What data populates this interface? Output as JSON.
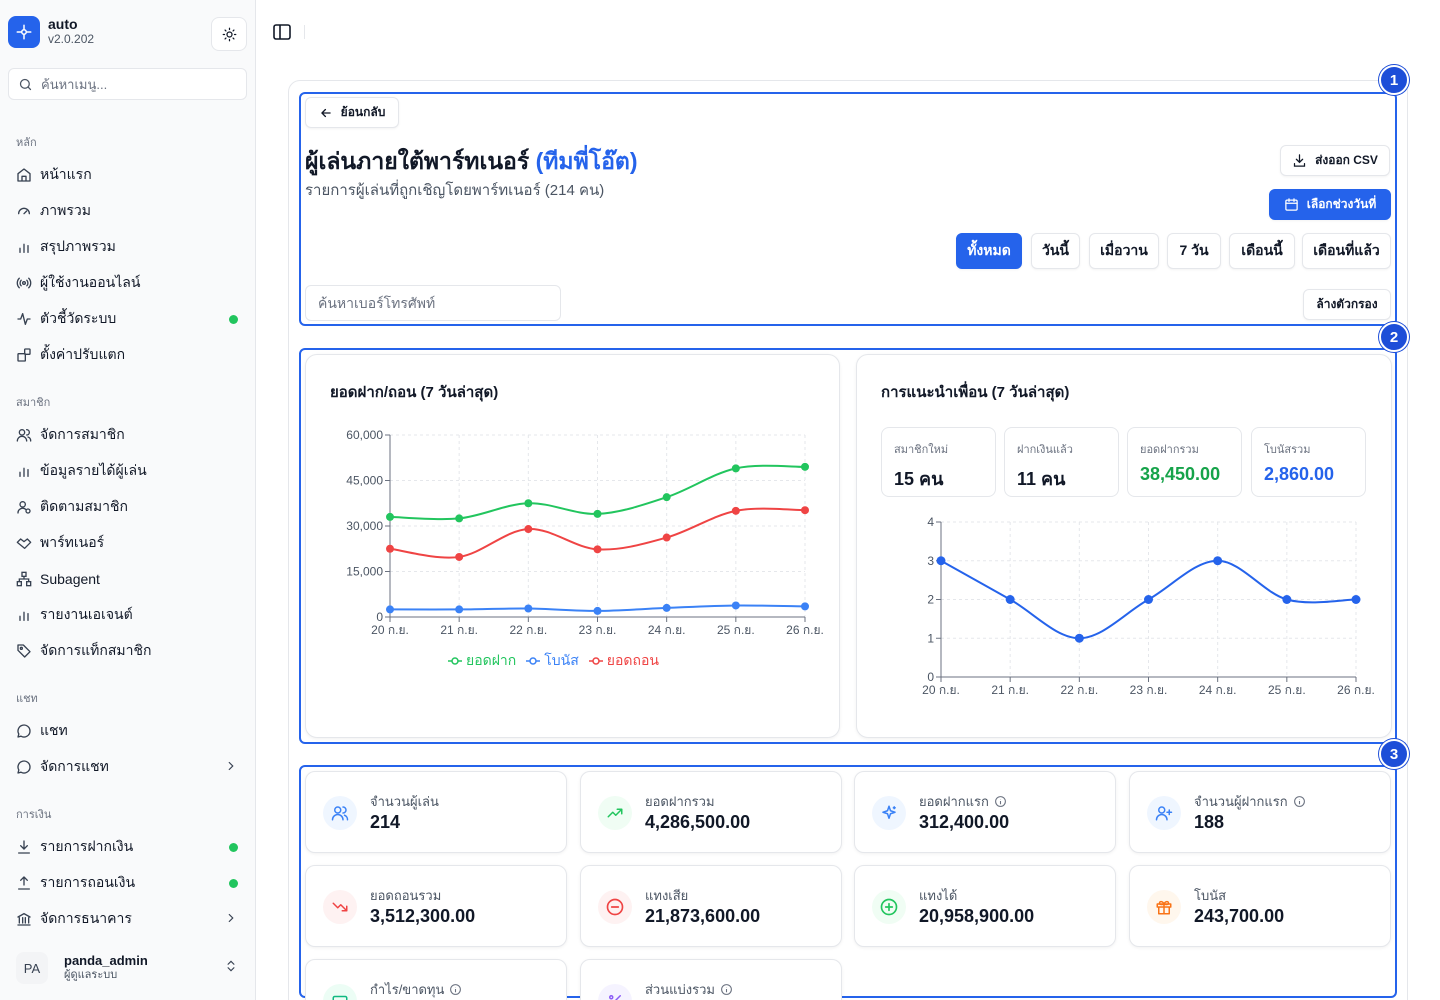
{
  "app": {
    "name": "auto",
    "version": "v2.0.202"
  },
  "sidebar": {
    "search_placeholder": "ค้นหาเมนู...",
    "sections": [
      {
        "title": "หลัก",
        "items": [
          {
            "label": "หน้าแรก"
          },
          {
            "label": "ภาพรวม"
          },
          {
            "label": "สรุปภาพรวม"
          },
          {
            "label": "ผู้ใช้งานออนไลน์"
          },
          {
            "label": "ตัวชี้วัดระบบ"
          },
          {
            "label": "ตั้งค่าปรับแตก"
          }
        ]
      },
      {
        "title": "สมาชิก",
        "items": [
          {
            "label": "จัดการสมาชิก"
          },
          {
            "label": "ข้อมูลรายได้ผู้เล่น"
          },
          {
            "label": "ติดตามสมาชิก"
          },
          {
            "label": "พาร์ทเนอร์"
          },
          {
            "label": "Subagent"
          },
          {
            "label": "รายงานเอเจนต์"
          },
          {
            "label": "จัดการแท็กสมาชิก"
          }
        ]
      },
      {
        "title": "แชท",
        "items": [
          {
            "label": "แชท"
          },
          {
            "label": "จัดการแชท"
          }
        ]
      },
      {
        "title": "การเงิน",
        "items": [
          {
            "label": "รายการฝากเงิน"
          },
          {
            "label": "รายการถอนเงิน"
          },
          {
            "label": "จัดการธนาคาร"
          }
        ]
      }
    ],
    "user": {
      "initials": "PA",
      "name": "panda_admin",
      "role": "ผู้ดูแลระบบ"
    }
  },
  "badges": [
    "1",
    "2",
    "3"
  ],
  "header": {
    "back_label": "ย้อนกลับ",
    "title": "ผู้เล่นภายใต้พาร์ทเนอร์",
    "title_accent": "(ทีมพี่โอ๊ต)",
    "subtitle": "รายการผู้เล่นที่ถูกเชิญโดยพาร์ทเนอร์ (214 คน)",
    "export_label": "ส่งออก CSV",
    "date_range_label": "เลือกช่วงวันที่",
    "filters": [
      "ทั้งหมด",
      "วันนี้",
      "เมื่อวาน",
      "7 วัน",
      "เดือนนี้",
      "เดือนที่แล้ว"
    ],
    "active_filter": 0,
    "phone_placeholder": "ค้นหาเบอร์โทรศัพท์",
    "clear_label": "ล้างตัวกรอง"
  },
  "colors": {
    "accent": "#2563eb",
    "deposit": "#22c55e",
    "bonus": "#3b82f6",
    "withdraw": "#ef4444"
  },
  "chart_data": [
    {
      "type": "line",
      "title": "ยอดฝาก/ถอน (7 วันล่าสุด)",
      "categories": [
        "20 ก.ย.",
        "21 ก.ย.",
        "22 ก.ย.",
        "23 ก.ย.",
        "24 ก.ย.",
        "25 ก.ย.",
        "26 ก.ย."
      ],
      "yticks": [
        "0",
        "15,000",
        "30,000",
        "45,000",
        "60,000"
      ],
      "ylim": [
        0,
        60000
      ],
      "grid": true,
      "legend_position": "bottom",
      "series": [
        {
          "name": "ยอดฝาก",
          "color": "#22c55e",
          "values": [
            33000,
            32500,
            37500,
            34000,
            39500,
            49000,
            49500
          ]
        },
        {
          "name": "โบนัส",
          "color": "#3b82f6",
          "values": [
            2500,
            2500,
            2800,
            2000,
            3000,
            3800,
            3500
          ]
        },
        {
          "name": "ยอดถอน",
          "color": "#ef4444",
          "values": [
            22500,
            19800,
            29000,
            22300,
            26200,
            35000,
            35200
          ]
        }
      ]
    },
    {
      "type": "line",
      "title": "การแนะนำเพื่อน (7 วันล่าสุด)",
      "categories": [
        "20 ก.ย.",
        "21 ก.ย.",
        "22 ก.ย.",
        "23 ก.ย.",
        "24 ก.ย.",
        "25 ก.ย.",
        "26 ก.ย."
      ],
      "yticks": [
        "0",
        "1",
        "2",
        "3",
        "4"
      ],
      "ylim": [
        0,
        4
      ],
      "grid": true,
      "series": [
        {
          "color": "#2563eb",
          "values": [
            3,
            2,
            1,
            2,
            3,
            2,
            2
          ]
        }
      ]
    }
  ],
  "referral_stats": [
    {
      "label": "สมาชิกใหม่",
      "value": "15 คน",
      "color": "#111827"
    },
    {
      "label": "ฝากเงินแล้ว",
      "value": "11 คน",
      "color": "#111827"
    },
    {
      "label": "ยอดฝากรวม",
      "value": "38,450.00",
      "color": "#16a34a"
    },
    {
      "label": "โบนัสรวม",
      "value": "2,860.00",
      "color": "#2563eb"
    }
  ],
  "stats": [
    {
      "label": "จำนวนผู้เล่น",
      "value": "214",
      "icon": "users-icon",
      "info": false
    },
    {
      "label": "ยอดฝากรวม",
      "value": "4,286,500.00",
      "icon": "trending-up-icon",
      "info": false
    },
    {
      "label": "ยอดฝากแรก",
      "value": "312,400.00",
      "icon": "sparkles-icon",
      "info": true
    },
    {
      "label": "จำนวนผู้ฝากแรก",
      "value": "188",
      "icon": "user-plus-icon",
      "info": true
    },
    {
      "label": "ยอดถอนรวม",
      "value": "3,512,300.00",
      "icon": "trending-down-icon",
      "info": false
    },
    {
      "label": "แทงเสีย",
      "value": "21,873,600.00",
      "icon": "minus-circle-icon",
      "info": false
    },
    {
      "label": "แทงได้",
      "value": "20,958,900.00",
      "icon": "plus-circle-icon",
      "info": false
    },
    {
      "label": "โบนัส",
      "value": "243,700.00",
      "icon": "gift-icon",
      "info": false
    },
    {
      "label": "กำไร/ขาดทุน",
      "value": "",
      "icon": "wallet-icon",
      "info": true
    },
    {
      "label": "ส่วนแบ่งรวม",
      "value": "",
      "icon": "percent-icon",
      "info": true
    }
  ]
}
